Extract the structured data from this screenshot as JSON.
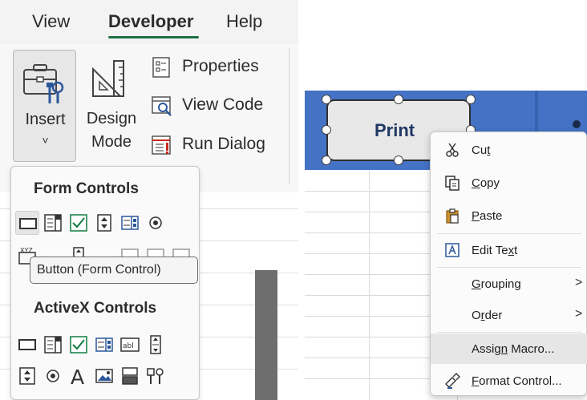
{
  "ribbon": {
    "tabs": [
      {
        "label": "View"
      },
      {
        "label": "Developer",
        "active": true
      },
      {
        "label": "Help"
      }
    ],
    "insert_label": "Insert",
    "insert_chevron": "˅",
    "design_mode_line1": "Design",
    "design_mode_line2": "Mode",
    "properties_label": "Properties",
    "view_code_label": "View Code",
    "run_dialog_label": "Run Dialog"
  },
  "gallery": {
    "form_controls_header": "Form Controls",
    "activex_controls_header": "ActiveX Controls",
    "tooltip": "Button (Form Control)",
    "form_controls_row1_icons": [
      "button-icon",
      "combo-box-icon",
      "check-box-icon",
      "spin-button-icon",
      "list-box-icon",
      "option-button-icon"
    ],
    "form_controls_row2_first_label": "XYZ",
    "activex_row1_icons": [
      "command-button-icon",
      "combo-box-icon",
      "check-box-icon",
      "list-box-icon",
      "text-box-icon",
      "scroll-bar-icon"
    ],
    "activex_row2_icons": [
      "spin-button-icon",
      "option-button-icon",
      "label-icon",
      "image-icon",
      "toggle-button-icon",
      "more-controls-icon"
    ],
    "activex_label_glyph": "A",
    "textbox_glyph": "abl"
  },
  "sheet": {
    "button_label": "Print"
  },
  "context_menu": {
    "items": [
      {
        "pre": "Cu",
        "ul": "t",
        "post": "",
        "icon": "cut-icon"
      },
      {
        "pre": "",
        "ul": "C",
        "post": "opy",
        "icon": "copy-icon"
      },
      {
        "pre": "",
        "ul": "P",
        "post": "aste",
        "icon": "paste-icon"
      },
      {
        "pre": "Edit Te",
        "ul": "x",
        "post": "t",
        "icon": "edit-text-icon"
      },
      {
        "pre": "",
        "ul": "G",
        "post": "rouping",
        "has_submenu": true
      },
      {
        "pre": "O",
        "ul": "r",
        "post": "der",
        "has_submenu": true
      },
      {
        "pre": "Assig",
        "ul": "n",
        "post": " Macro...",
        "highlighted": true
      },
      {
        "pre": "",
        "ul": "F",
        "post": "ormat Control...",
        "icon": "format-control-icon"
      }
    ],
    "submenu_arrow": ">"
  },
  "colors": {
    "accent_green": "#1e7145",
    "header_blue": "#4472c4",
    "button_text_navy": "#203864",
    "check_green": "#107c41",
    "icon_blue": "#2b579a",
    "icon_red": "#c42b1c"
  }
}
